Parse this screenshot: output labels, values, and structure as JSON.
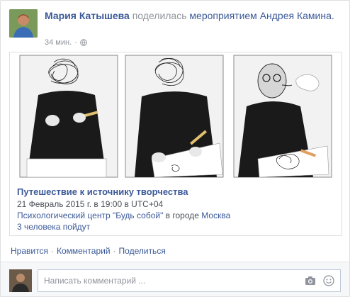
{
  "post": {
    "author": "Мария Катышева",
    "verb": "поделилась",
    "link_text": "мероприятием Андрея Камина.",
    "time": "34 мин.",
    "sep": "·"
  },
  "event": {
    "title": "Путешествие к источнику творчества",
    "datetime": "21 Февраль 2015 г. в 19:00 в UTC+04",
    "venue": "Психологический центр \"Будь собой\"",
    "venue_mid": " в городе ",
    "city": "Москва",
    "going": "3 человека пойдут"
  },
  "actions": {
    "like": "Нравится",
    "comment": "Комментарий",
    "share": "Поделиться",
    "sep": "·"
  },
  "comment_box": {
    "placeholder": "Написать комментарий ..."
  },
  "icons": {
    "globe": "globe-icon",
    "camera": "camera-icon",
    "emoji": "emoji-icon"
  }
}
